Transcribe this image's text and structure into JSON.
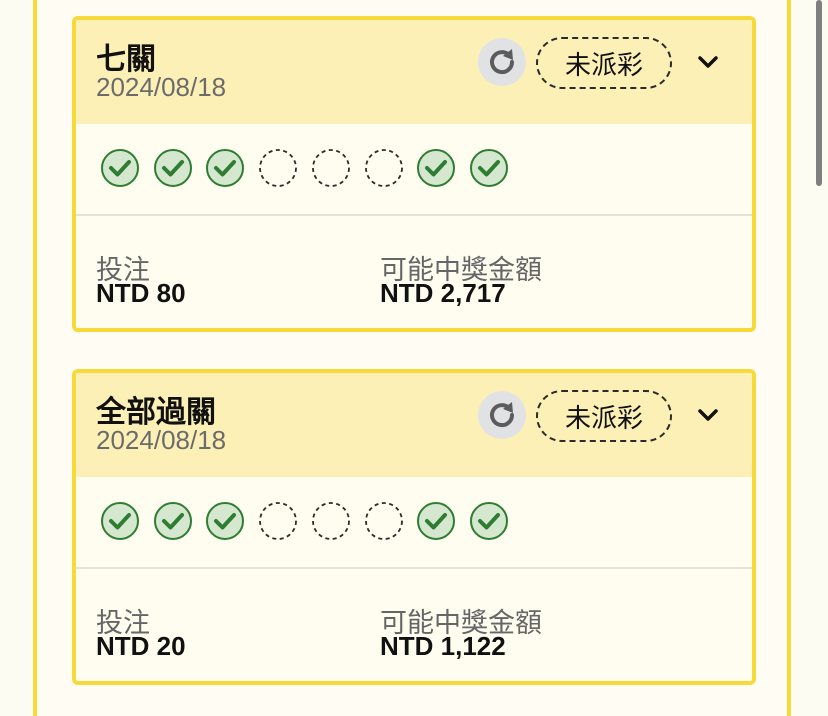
{
  "cards": [
    {
      "title": "七關",
      "date": "2024/08/18",
      "status": "未派彩",
      "legs": [
        "won",
        "won",
        "won",
        "pending",
        "pending",
        "pending",
        "won",
        "won"
      ],
      "stake_label": "投注",
      "stake_value": "NTD 80",
      "payout_label": "可能中獎金額",
      "payout_value": "NTD 2,717"
    },
    {
      "title": "全部過關",
      "date": "2024/08/18",
      "status": "未派彩",
      "legs": [
        "won",
        "won",
        "won",
        "pending",
        "pending",
        "pending",
        "won",
        "won"
      ],
      "stake_label": "投注",
      "stake_value": "NTD 20",
      "payout_label": "可能中獎金額",
      "payout_value": "NTD 1,122"
    }
  ],
  "colors": {
    "accent_border": "#f7d93a",
    "header_bg": "#fdf0b7",
    "won_fill": "#d5e8cf",
    "won_stroke": "#2e7d32"
  },
  "icons": {
    "refresh": "refresh-icon",
    "expand": "chevron-down-icon",
    "won": "check-circle-icon",
    "pending": "dashed-circle-icon"
  }
}
